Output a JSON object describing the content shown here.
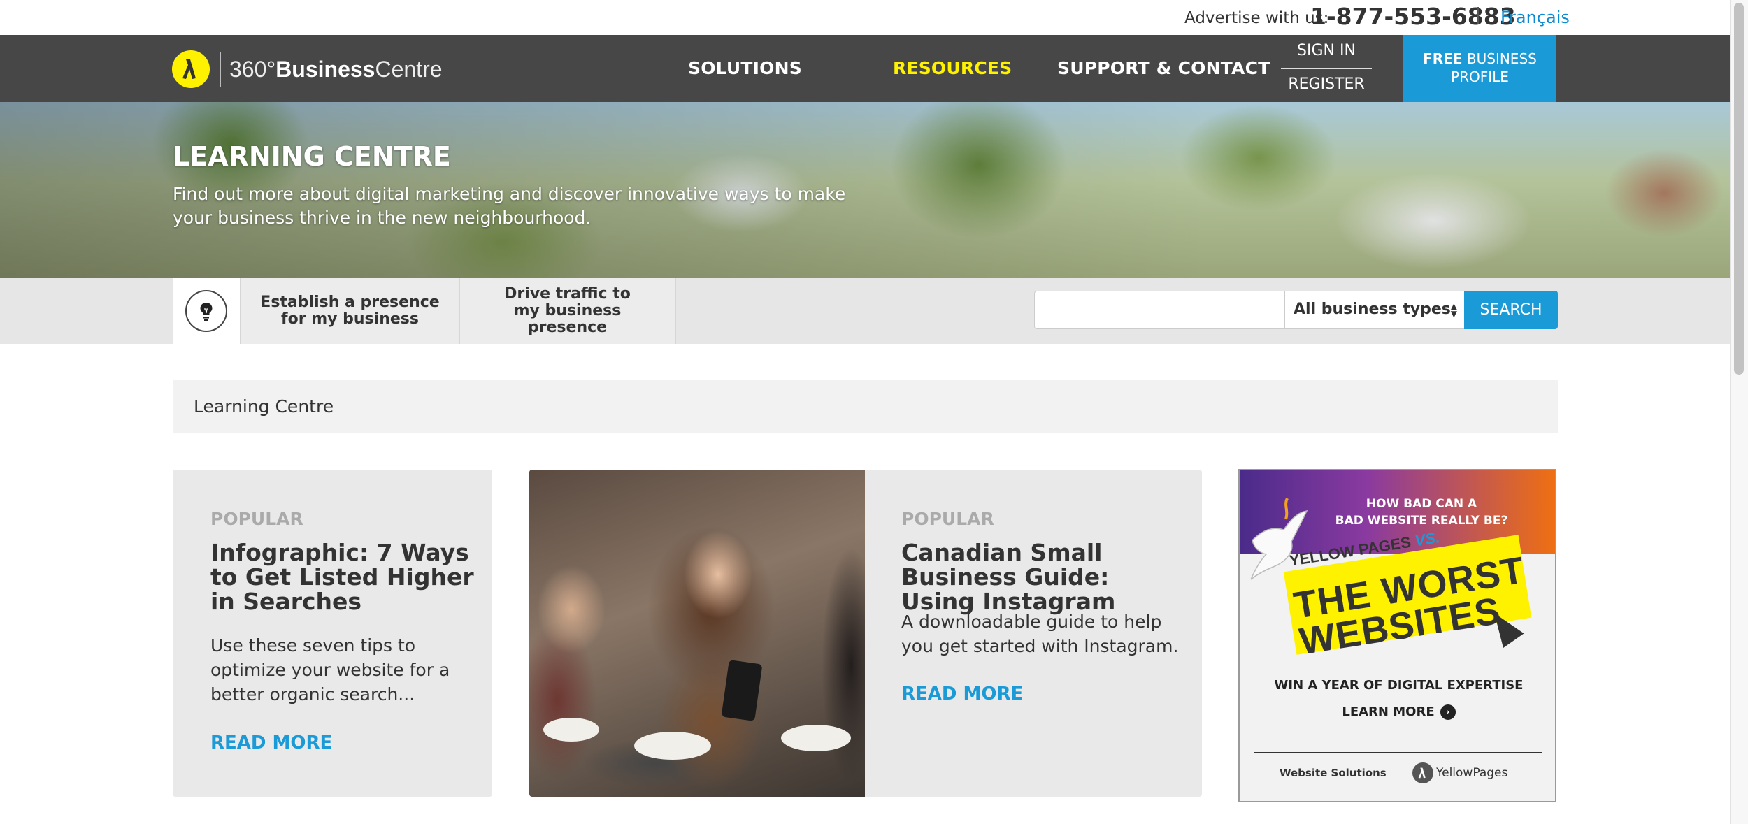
{
  "topbar": {
    "advertise_label": "Advertise with us:",
    "phone": "1-877-553-6883",
    "language": "Français"
  },
  "nav": {
    "brand_prefix": "360°",
    "brand_strong": "Business",
    "brand_suffix": "Centre",
    "items": [
      {
        "label": "SOLUTIONS"
      },
      {
        "label": "RESOURCES",
        "active": true
      },
      {
        "label": "SUPPORT & CONTACT"
      }
    ],
    "sign_in": "SIGN IN",
    "register": "REGISTER",
    "cta_strong": "FREE",
    "cta_rest": "BUSINESS",
    "cta_line2": "PROFILE"
  },
  "hero": {
    "title": "LEARNING CENTRE",
    "subtitle": "Find out more about digital marketing and discover innovative ways to make your business thrive in the new neighbourhood."
  },
  "filter": {
    "icon": "lightbulb-icon",
    "tabs": [
      {
        "label": "Establish a presence for my business"
      },
      {
        "label": "Drive traffic to my business presence"
      }
    ],
    "search_value": "",
    "select_value": "All business types",
    "search_button": "SEARCH"
  },
  "breadcrumb": {
    "current": "Learning Centre"
  },
  "cards": [
    {
      "kicker": "POPULAR",
      "title": "Infographic: 7 Ways to Get Listed Higher in Searches",
      "description": "Use these seven tips to optimize your website for a better organic search...",
      "read_more": "READ MORE"
    },
    {
      "kicker": "POPULAR",
      "title": "Canadian Small Business Guide: Using Instagram",
      "description": "A downloadable guide to help you get started with Instagram.",
      "read_more": "READ MORE"
    }
  ],
  "ad": {
    "question_line1": "HOW BAD CAN A",
    "question_line2": "BAD WEBSITE REALLY BE?",
    "yp": "YELLOW PAGES",
    "vs": "VS.",
    "headline_line1": "THE WORST",
    "headline_line2": "WEBSITES",
    "win": "WIN A YEAR OF DIGITAL EXPERTISE",
    "learn_more": "LEARN MORE",
    "footer_left": "Website Solutions",
    "footer_right": "YellowPages"
  },
  "colors": {
    "accent_blue": "#1a9ad6",
    "brand_yellow": "#fff200",
    "nav_bg": "#3c3c3c"
  }
}
